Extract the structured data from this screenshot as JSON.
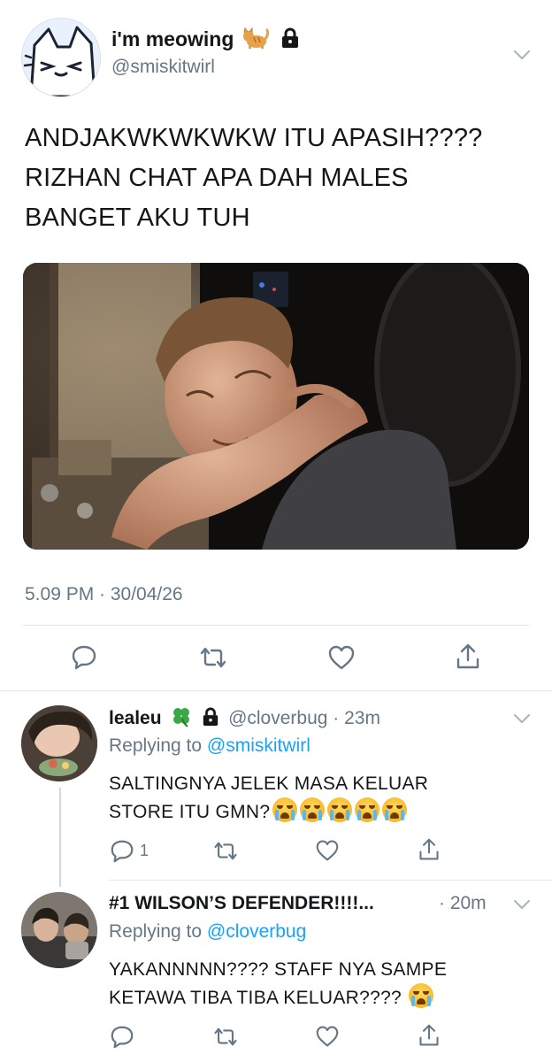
{
  "main_tweet": {
    "display_name": "i'm meowing",
    "handle": "@smiskitwirl",
    "text_lines": [
      "ANDJAKWKWKWKW ITU APASIH????",
      "RIZHAN CHAT APA DAH MALES",
      "BANGET AKU TUH"
    ],
    "timestamp": "5.09 PM · 30/04/26",
    "name_emoji": "cat-emoji",
    "locked": true
  },
  "replies": [
    {
      "display_name": "lealeu",
      "name_emoji": "four-leaf-clover-emoji",
      "locked": true,
      "handle": "@cloverbug",
      "time": "· 23m",
      "replying_prefix": "Replying to",
      "replying_handle": "@smiskitwirl",
      "text_lines": [
        "SALTINGNYA JELEK MASA KELUAR",
        "STORE ITU GMN?"
      ],
      "trailing_emoji_count": 5,
      "reply_count": "1"
    },
    {
      "display_name": "#1 WILSON’S DEFENDER!!!!...",
      "time": "· 20m",
      "replying_prefix": "Replying to",
      "replying_handle": "@cloverbug",
      "text_lines": [
        "YAKANNNNN???? STAFF NYA SAMPE",
        "KETAWA TIBA TIBA KELUAR????"
      ],
      "trailing_emoji_count": 1,
      "reply_count": ""
    }
  ],
  "colors": {
    "accent": "#1da1f2",
    "muted": "#657786",
    "divider": "#e1e8ed",
    "text": "#14171a"
  },
  "icons": [
    "reply-icon",
    "retweet-icon",
    "like-icon",
    "share-icon",
    "chevron-down-icon",
    "lock-icon",
    "crying-face-emoji"
  ]
}
